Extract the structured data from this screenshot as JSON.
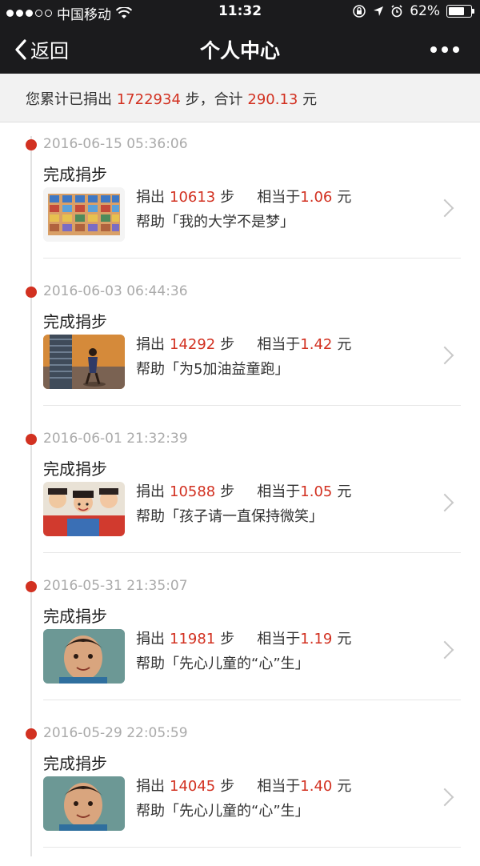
{
  "status_bar": {
    "carrier": "中国移动",
    "time": "11:32",
    "battery": "62%"
  },
  "nav": {
    "back_label": "返回",
    "title": "个人中心"
  },
  "summary": {
    "prefix": "您累计已捐出",
    "steps": "1722934",
    "mid": "步，合计",
    "amount": "290.13",
    "suffix": "元"
  },
  "labels": {
    "donate": "捐出",
    "steps_unit": "步",
    "equals": "相当于",
    "yuan": "元",
    "help": "帮助"
  },
  "entries": [
    {
      "date": "2016-06-15 05:36:06",
      "status": "完成捐步",
      "steps": "10613",
      "amount": "1.06",
      "project": "「我的大学不是梦」"
    },
    {
      "date": "2016-06-03 06:44:36",
      "status": "完成捐步",
      "steps": "14292",
      "amount": "1.42",
      "project": "「为5加油益童跑」"
    },
    {
      "date": "2016-06-01 21:32:39",
      "status": "完成捐步",
      "steps": "10588",
      "amount": "1.05",
      "project": "「孩子请一直保持微笑」"
    },
    {
      "date": "2016-05-31 21:35:07",
      "status": "完成捐步",
      "steps": "11981",
      "amount": "1.19",
      "project": "「先心儿童的“心”生」"
    },
    {
      "date": "2016-05-29 22:05:59",
      "status": "完成捐步",
      "steps": "14045",
      "amount": "1.40",
      "project": "「先心儿童的“心”生」"
    }
  ],
  "colors": {
    "accent": "#d23121",
    "nav_bg": "#1b1b1d"
  }
}
